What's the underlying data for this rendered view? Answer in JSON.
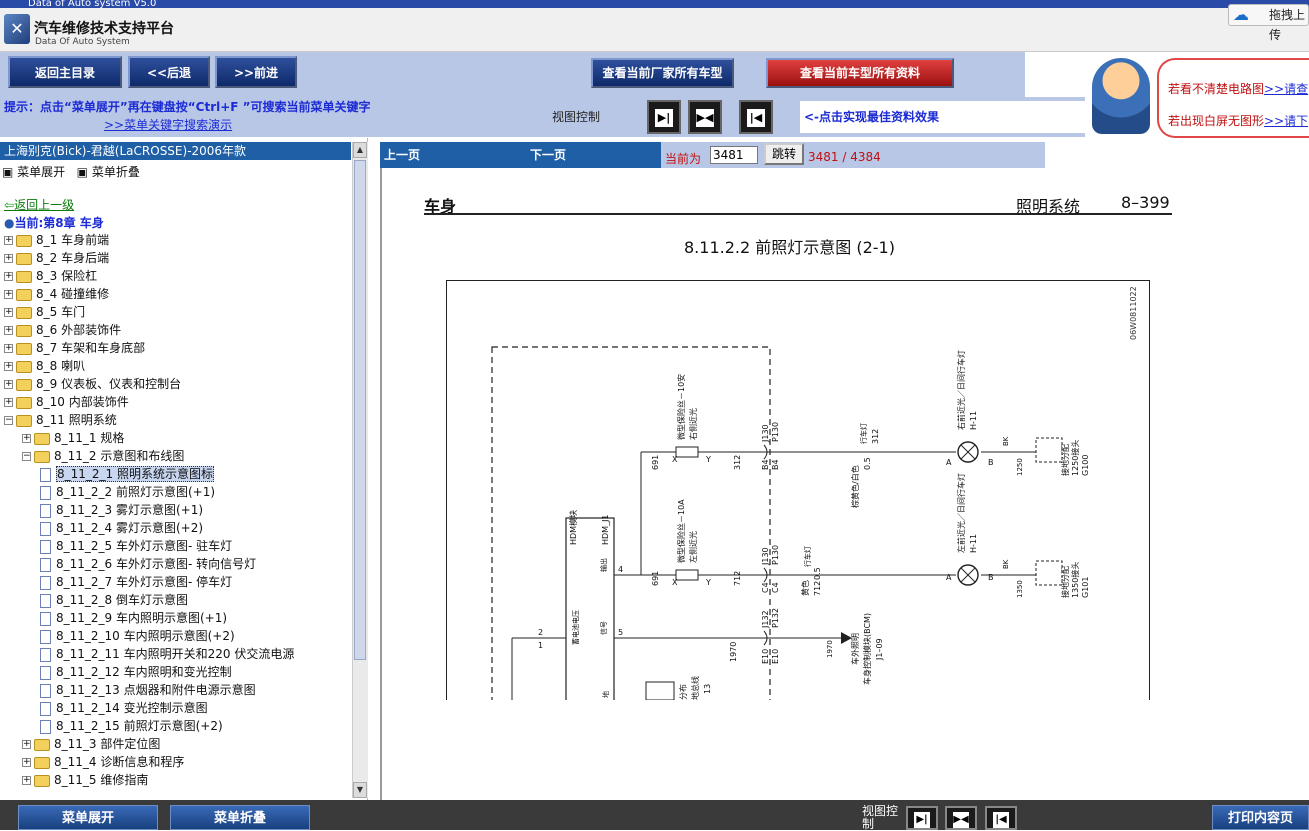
{
  "window": {
    "title": "Data of Auto system V5.0"
  },
  "app": {
    "title": "汽车维修技术支持平台",
    "subtitle": "Data Of Auto System",
    "drag_button": "拖拽上传"
  },
  "toolbar": {
    "home": "返回主目录",
    "back": "<<后退",
    "forward": ">>前进",
    "all_models": "查看当前厂家所有车型",
    "all_info": "查看当前车型所有资料"
  },
  "tip": {
    "text": "提示：点击“菜单展开”再在键盘按“Ctrl+F ”可搜索当前菜单关键字",
    "link": ">>菜单关键字搜索演示"
  },
  "view_control": {
    "label": "视图控制",
    "best_effect": "<-点击实现最佳资料效果"
  },
  "notice": {
    "line1_text": "若看不清楚电路图",
    "line1_link": ">>请查",
    "line2_text": "若出现白屏无图形",
    "line2_link": ">>请下"
  },
  "sidebar": {
    "vehicle": "上海别克(Bick)-君越(LaCROSSE)-2006年款",
    "expand_menu": "菜单展开",
    "collapse_menu": "菜单折叠",
    "back_up": "返回上一级",
    "current_chapter": "当前:第8章  车身",
    "items": [
      {
        "label": "8_1 车身前端"
      },
      {
        "label": "8_2 车身后端"
      },
      {
        "label": "8_3 保险杠"
      },
      {
        "label": "8_4 碰撞维修"
      },
      {
        "label": "8_5 车门"
      },
      {
        "label": "8_6 外部装饰件"
      },
      {
        "label": "8_7 车架和车身底部"
      },
      {
        "label": "8_8 喇叭"
      },
      {
        "label": "8_9 仪表板、仪表和控制台"
      },
      {
        "label": "8_10 内部装饰件"
      },
      {
        "label": "8_11 照明系统"
      },
      {
        "label": "8_11_1 规格"
      },
      {
        "label": "8_11_2 示意图和布线图"
      },
      {
        "label": "8_11_2_1 照明系统示意图标"
      },
      {
        "label": "8_11_2_2 前照灯示意图(+1)"
      },
      {
        "label": "8_11_2_3 雾灯示意图(+1)"
      },
      {
        "label": "8_11_2_4 雾灯示意图(+2)"
      },
      {
        "label": "8_11_2_5 车外灯示意图- 驻车灯"
      },
      {
        "label": "8_11_2_6 车外灯示意图- 转向信号灯"
      },
      {
        "label": "8_11_2_7 车外灯示意图- 停车灯"
      },
      {
        "label": "8_11_2_8 倒车灯示意图"
      },
      {
        "label": "8_11_2_9 车内照明示意图(+1)"
      },
      {
        "label": "8_11_2_10 车内照明示意图(+2)"
      },
      {
        "label": "8_11_2_11 车内照明开关和220 伏交流电源"
      },
      {
        "label": "8_11_2_12 车内照明和变光控制"
      },
      {
        "label": "8_11_2_13 点烟器和附件电源示意图"
      },
      {
        "label": "8_11_2_14 变光控制示意图"
      },
      {
        "label": "8_11_2_15 前照灯示意图(+2)"
      },
      {
        "label": "8_11_3 部件定位图"
      },
      {
        "label": "8_11_4 诊断信息和程序"
      },
      {
        "label": "8_11_5 维修指南"
      }
    ]
  },
  "page_nav": {
    "prev": "上一页",
    "next": "下一页",
    "current_label": "当前为",
    "current_value": "3481",
    "jump": "跳转",
    "count": "3481 / 4384"
  },
  "document": {
    "section": "车身",
    "system": "照明系统",
    "page_number": "8–399",
    "title": "8.11.2.2 前照灯示意图 (2-1)",
    "diagram": {
      "code": "06W0811022",
      "hdm": "HDM模块",
      "hdm_j1": "HDM_J1",
      "fuse_right": "微型保险丝－10安",
      "fuse_right_sub": "右侧近光",
      "fuse_left": "微型保险丝－10A",
      "fuse_left_sub": "左侧近光",
      "lamp_right": "右前近光／日间行车灯",
      "lamp_right_code": "H-11",
      "lamp_left": "左前近光／日间行车灯",
      "lamp_left_code": "H-11",
      "ground_right": "接地分配",
      "ground_right_sub": "1250接头",
      "ground_right_code": "G100",
      "ground_left": "接地分配",
      "ground_left_sub": "1350接头",
      "ground_left_code": "G101",
      "bcm": "车外照明",
      "bcm_sub": "车身控制模块(BCM)",
      "bcm_code": "J1–09",
      "wire_right": "棕黄色/白色",
      "wire_right_size": "0.5",
      "wire_right_circuit": "312",
      "wire_right_tag": "行车灯",
      "wire_left": "黄色",
      "wire_left_size": "0.5",
      "wire_left_circuit": "712",
      "wire_left_tag": "行车灯",
      "pin_output": "输出",
      "pin_signal": "信号",
      "pin_power": "蓄电池电压",
      "pin_ground": "地",
      "dist": "分布",
      "dist_sub": "地总线",
      "dist_code": "13",
      "conn_j130": "J130",
      "conn_p130": "P130",
      "conn_j132": "J132",
      "conn_p132": "P132",
      "b4": "B4",
      "c4": "C4",
      "e10": "E10",
      "n691": "691",
      "n312": "312",
      "n712": "712",
      "n1970": "1970",
      "n1250": "1250",
      "n1350": "1350",
      "bk": "BK",
      "x": "X",
      "y": "Y",
      "a": "A",
      "b": "B",
      "p1": "1",
      "p2": "2",
      "p4": "4",
      "p5": "5"
    }
  },
  "bottom": {
    "expand": "菜单展开",
    "collapse": "菜单折叠",
    "view_label": "视图控制",
    "print": "打印内容页"
  }
}
